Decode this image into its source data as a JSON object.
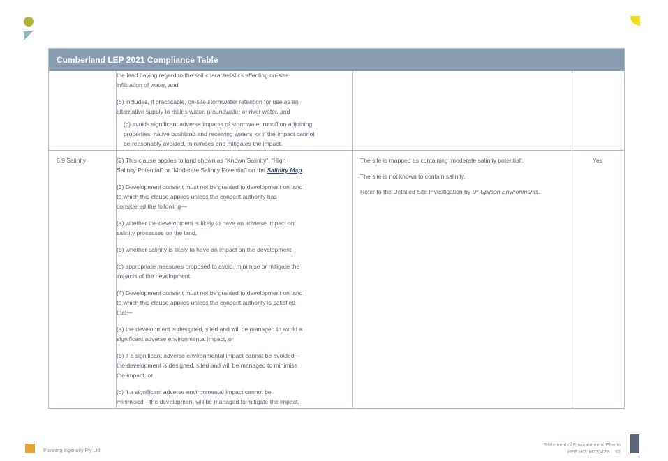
{
  "table": {
    "title": "Cumberland LEP 2021 Compliance Table",
    "continued_row": {
      "clause_lines": [
        "the land having regard to the soil characteristics affecting on-site",
        "infiltration of water, and",
        "(b)  includes, if practicable, on-site stormwater retention for use as an",
        "alternative supply to mains water, groundwater or river water, and",
        "(c)  avoids significant adverse impacts of stormwater runoff on adjoining",
        "properties, native bushland and receiving waters, or if the impact cannot",
        "be reasonably avoided, minimises and mitigates the impact."
      ]
    },
    "salinity_row": {
      "clause_title": "6.9 Salinity",
      "intro_line1": "(2)  This clause applies to land shown as “Known Salinity”, “High",
      "intro_line2_prefix": "Salinity Potential” or “Moderate Salinity Potential” on the ",
      "salinity_map_link": "Salinity Map",
      "intro_line2_suffix": ".",
      "clause_lines": [
        "(3)  Development consent must not be granted to development on land",
        "to which this clause applies unless the consent authority has",
        "considered the following—",
        "(a)  whether the development is likely to have an adverse impact on",
        "salinity processes on the land,",
        "(b)  whether salinity is likely to have an impact on the development,",
        "(c)  appropriate measures proposed to avoid, minimise or mitigate the",
        "impacts of the development.",
        "(4)  Development consent must not be granted to development on land",
        "to which this clause applies unless the consent authority is satisfied",
        "that—",
        "(a)  the development is designed, sited and will be managed to avoid a",
        "significant adverse environmental impact, or",
        "(b)  if a significant adverse environmental impact cannot be avoided—",
        "the development is designed, sited and will be managed to minimise",
        "the impact, or",
        "(c)  if a significant adverse environmental impact cannot be",
        "minimised—the development will be managed to mitigate the impact."
      ],
      "comment_1": "The site is mapped as containing ‘moderate salinity potential’.",
      "comment_2": "The site is not known to contain salinity.",
      "comment_3_prefix": "Refer to the Detailed Site Investigation by ",
      "comment_3_author": "Dr Upilson Environments",
      "comment_3_suffix": ".",
      "compliance": "Yes"
    }
  },
  "footer": {
    "company": "Planning Ingenuity Pty Ltd",
    "doc_title": "Statement of Environmental Effects",
    "ref": "REF NO: M23042B",
    "page_number": "62"
  },
  "colors": {
    "header_bg": "#8a9caf",
    "accent_olive": "#b3b53d",
    "accent_teal": "#8fb7c2",
    "accent_yellow": "#f2dc1e",
    "accent_orange": "#e3a33a",
    "footer_bar": "#5a6676"
  }
}
